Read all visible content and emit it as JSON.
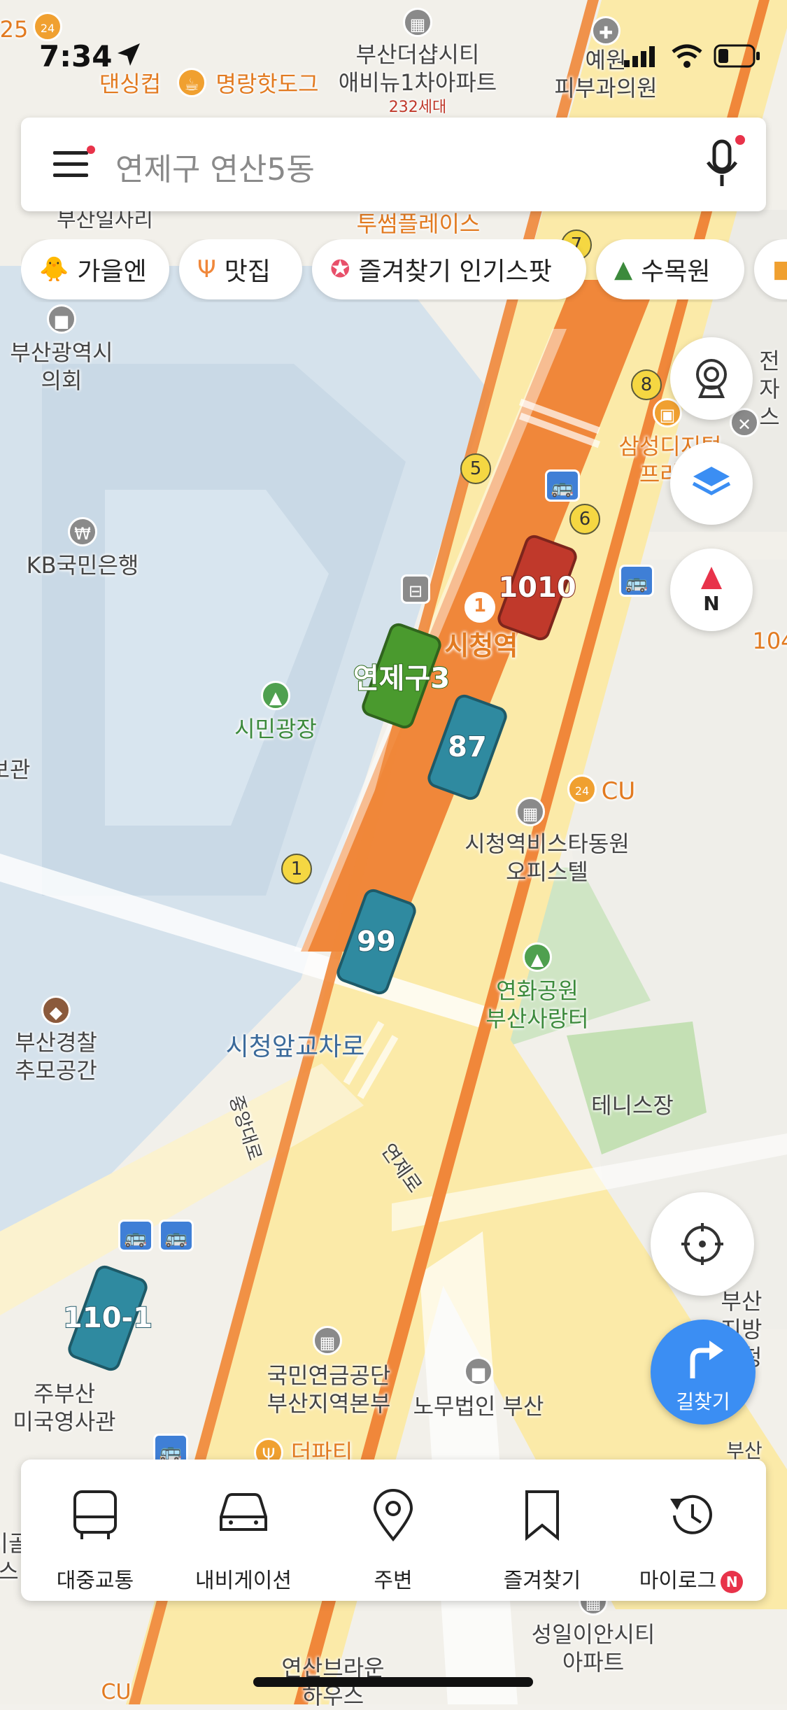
{
  "status_bar": {
    "time": "7:34"
  },
  "search": {
    "placeholder": "연제구 연산5동"
  },
  "chips": [
    {
      "label": "가을엔",
      "icon": "character-icon"
    },
    {
      "label": "맛집",
      "icon": "utensils-icon"
    },
    {
      "label": "즐겨찾기 인기스팟",
      "icon": "star-icon"
    },
    {
      "label": "수목원",
      "icon": "tree-icon"
    }
  ],
  "map": {
    "labels": {
      "apt1": "부산더샵시티\n애비뉴1차아파트",
      "apt1_sub": "232세대",
      "clinic": "예원\n피부과의원",
      "dancing_cup": "댄싱컵",
      "hotdog": "명랑핫도그",
      "toosome": "투썸플레이스",
      "busan_office": "부산일사리",
      "council": "부산광역시\n의회",
      "kb": "KB국민은행",
      "samsung": "삼성디지털\n프라자",
      "samsung_partial": "전자\n스",
      "station": "시청역",
      "citizen_plaza": "시민광장",
      "cu1": "CU",
      "vista": "시청역비스타동원\n오피스텔",
      "yeonhwa": "연화공원\n부산사랑터",
      "police": "부산경찰\n추모공간",
      "crossroad": "시청앞교차로",
      "jungang": "중앙대로",
      "yeonje_road": "연제로",
      "tennis": "테니스장",
      "left_partial": "보관",
      "pension": "국민연금공단\n부산지역본부",
      "law": "노무법인 부산",
      "consulate": "주부산\n미국영사관",
      "busan_branch": "부산지방\n동청",
      "city_hall_right": "부산광역시\n선거",
      "the_party": "더파티",
      "seongil": "성일이안시티\n아파트",
      "brown": "연산브라운\n하우스",
      "cu2": "CU",
      "left_bottom": "이골\n스",
      "num_104": "104",
      "num_25": "25"
    },
    "exits": [
      "1",
      "5",
      "6",
      "7",
      "8"
    ],
    "station_number": "1",
    "buses": [
      {
        "label": "1010",
        "color": "#c0392b"
      },
      {
        "label": "연제구3",
        "color": "#4a9a2e"
      },
      {
        "label": "87",
        "color": "#2f8aa0"
      },
      {
        "label": "99",
        "color": "#2f8aa0"
      },
      {
        "label": "110-1",
        "color": "#2f8aa0"
      }
    ]
  },
  "fabs": {
    "route_label": "길찾기"
  },
  "bottom_nav": [
    {
      "label": "대중교통",
      "icon": "bus-icon"
    },
    {
      "label": "내비게이션",
      "icon": "car-icon"
    },
    {
      "label": "주변",
      "icon": "location-pin-icon"
    },
    {
      "label": "즐겨찾기",
      "icon": "bookmark-icon"
    },
    {
      "label": "마이로그",
      "icon": "history-icon",
      "badge": "N"
    }
  ],
  "colors": {
    "accent_blue": "#3b8ef3",
    "route_orange": "#f0873a",
    "road_yellow": "#fbe9a6",
    "badge_red": "#e8334a"
  }
}
